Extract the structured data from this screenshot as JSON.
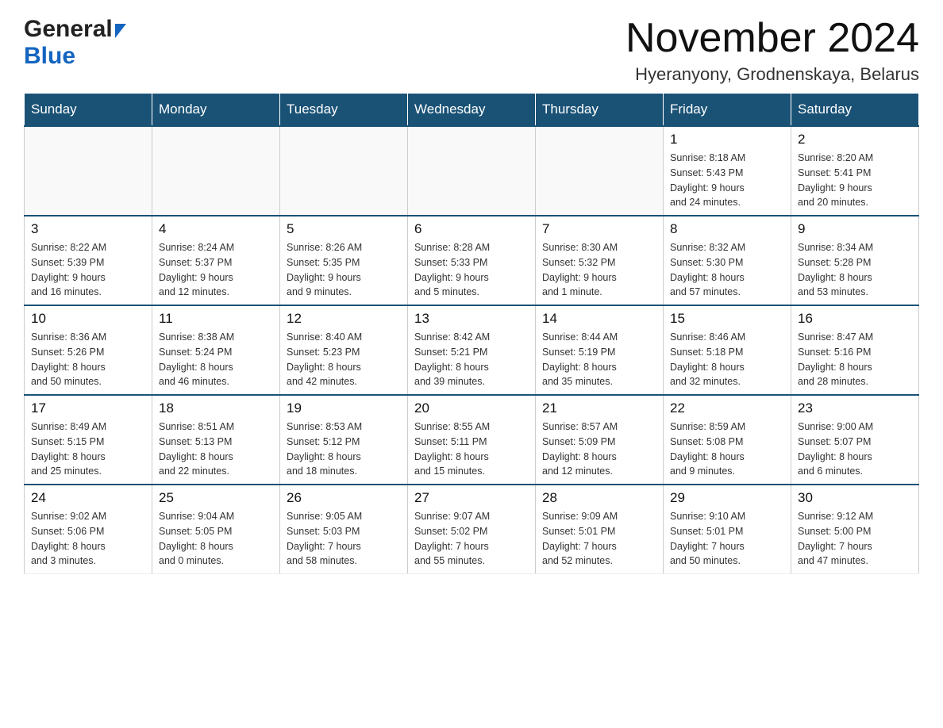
{
  "logo": {
    "general": "General",
    "blue": "Blue"
  },
  "header": {
    "title": "November 2024",
    "subtitle": "Hyeranyony, Grodnenskaya, Belarus"
  },
  "weekdays": [
    "Sunday",
    "Monday",
    "Tuesday",
    "Wednesday",
    "Thursday",
    "Friday",
    "Saturday"
  ],
  "weeks": [
    [
      {
        "day": "",
        "info": ""
      },
      {
        "day": "",
        "info": ""
      },
      {
        "day": "",
        "info": ""
      },
      {
        "day": "",
        "info": ""
      },
      {
        "day": "",
        "info": ""
      },
      {
        "day": "1",
        "info": "Sunrise: 8:18 AM\nSunset: 5:43 PM\nDaylight: 9 hours\nand 24 minutes."
      },
      {
        "day": "2",
        "info": "Sunrise: 8:20 AM\nSunset: 5:41 PM\nDaylight: 9 hours\nand 20 minutes."
      }
    ],
    [
      {
        "day": "3",
        "info": "Sunrise: 8:22 AM\nSunset: 5:39 PM\nDaylight: 9 hours\nand 16 minutes."
      },
      {
        "day": "4",
        "info": "Sunrise: 8:24 AM\nSunset: 5:37 PM\nDaylight: 9 hours\nand 12 minutes."
      },
      {
        "day": "5",
        "info": "Sunrise: 8:26 AM\nSunset: 5:35 PM\nDaylight: 9 hours\nand 9 minutes."
      },
      {
        "day": "6",
        "info": "Sunrise: 8:28 AM\nSunset: 5:33 PM\nDaylight: 9 hours\nand 5 minutes."
      },
      {
        "day": "7",
        "info": "Sunrise: 8:30 AM\nSunset: 5:32 PM\nDaylight: 9 hours\nand 1 minute."
      },
      {
        "day": "8",
        "info": "Sunrise: 8:32 AM\nSunset: 5:30 PM\nDaylight: 8 hours\nand 57 minutes."
      },
      {
        "day": "9",
        "info": "Sunrise: 8:34 AM\nSunset: 5:28 PM\nDaylight: 8 hours\nand 53 minutes."
      }
    ],
    [
      {
        "day": "10",
        "info": "Sunrise: 8:36 AM\nSunset: 5:26 PM\nDaylight: 8 hours\nand 50 minutes."
      },
      {
        "day": "11",
        "info": "Sunrise: 8:38 AM\nSunset: 5:24 PM\nDaylight: 8 hours\nand 46 minutes."
      },
      {
        "day": "12",
        "info": "Sunrise: 8:40 AM\nSunset: 5:23 PM\nDaylight: 8 hours\nand 42 minutes."
      },
      {
        "day": "13",
        "info": "Sunrise: 8:42 AM\nSunset: 5:21 PM\nDaylight: 8 hours\nand 39 minutes."
      },
      {
        "day": "14",
        "info": "Sunrise: 8:44 AM\nSunset: 5:19 PM\nDaylight: 8 hours\nand 35 minutes."
      },
      {
        "day": "15",
        "info": "Sunrise: 8:46 AM\nSunset: 5:18 PM\nDaylight: 8 hours\nand 32 minutes."
      },
      {
        "day": "16",
        "info": "Sunrise: 8:47 AM\nSunset: 5:16 PM\nDaylight: 8 hours\nand 28 minutes."
      }
    ],
    [
      {
        "day": "17",
        "info": "Sunrise: 8:49 AM\nSunset: 5:15 PM\nDaylight: 8 hours\nand 25 minutes."
      },
      {
        "day": "18",
        "info": "Sunrise: 8:51 AM\nSunset: 5:13 PM\nDaylight: 8 hours\nand 22 minutes."
      },
      {
        "day": "19",
        "info": "Sunrise: 8:53 AM\nSunset: 5:12 PM\nDaylight: 8 hours\nand 18 minutes."
      },
      {
        "day": "20",
        "info": "Sunrise: 8:55 AM\nSunset: 5:11 PM\nDaylight: 8 hours\nand 15 minutes."
      },
      {
        "day": "21",
        "info": "Sunrise: 8:57 AM\nSunset: 5:09 PM\nDaylight: 8 hours\nand 12 minutes."
      },
      {
        "day": "22",
        "info": "Sunrise: 8:59 AM\nSunset: 5:08 PM\nDaylight: 8 hours\nand 9 minutes."
      },
      {
        "day": "23",
        "info": "Sunrise: 9:00 AM\nSunset: 5:07 PM\nDaylight: 8 hours\nand 6 minutes."
      }
    ],
    [
      {
        "day": "24",
        "info": "Sunrise: 9:02 AM\nSunset: 5:06 PM\nDaylight: 8 hours\nand 3 minutes."
      },
      {
        "day": "25",
        "info": "Sunrise: 9:04 AM\nSunset: 5:05 PM\nDaylight: 8 hours\nand 0 minutes."
      },
      {
        "day": "26",
        "info": "Sunrise: 9:05 AM\nSunset: 5:03 PM\nDaylight: 7 hours\nand 58 minutes."
      },
      {
        "day": "27",
        "info": "Sunrise: 9:07 AM\nSunset: 5:02 PM\nDaylight: 7 hours\nand 55 minutes."
      },
      {
        "day": "28",
        "info": "Sunrise: 9:09 AM\nSunset: 5:01 PM\nDaylight: 7 hours\nand 52 minutes."
      },
      {
        "day": "29",
        "info": "Sunrise: 9:10 AM\nSunset: 5:01 PM\nDaylight: 7 hours\nand 50 minutes."
      },
      {
        "day": "30",
        "info": "Sunrise: 9:12 AM\nSunset: 5:00 PM\nDaylight: 7 hours\nand 47 minutes."
      }
    ]
  ]
}
